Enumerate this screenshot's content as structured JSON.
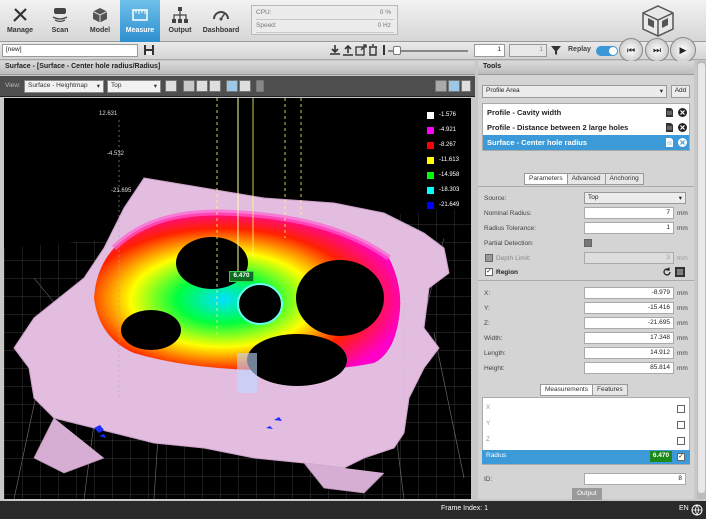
{
  "toolbar": {
    "items": [
      {
        "label": "Manage",
        "icon": "tools-icon"
      },
      {
        "label": "Scan",
        "icon": "scan-icon"
      },
      {
        "label": "Model",
        "icon": "cube-icon"
      },
      {
        "label": "Measure",
        "icon": "ruler-icon"
      },
      {
        "label": "Output",
        "icon": "network-icon"
      },
      {
        "label": "Dashboard",
        "icon": "dashboard-icon"
      }
    ],
    "active": "Measure",
    "cpu_label": "CPU:",
    "cpu_value": "0 %",
    "speed_label": "Speed:",
    "speed_value": "0 Hz"
  },
  "row2": {
    "job_select": "[new]",
    "frame_value": "1",
    "frame_total": "1",
    "replay_label": "Replay",
    "replay_on": true
  },
  "surface_panel": {
    "title": "Surface - [Surface - Center hole radius/Radius]",
    "view_label": "View:",
    "view_mode": "Surface - Heightmap",
    "view_direction": "Top"
  },
  "viewport": {
    "legend": [
      {
        "value": "-1.576",
        "color": "#ffffff"
      },
      {
        "value": "-4.921",
        "color": "#ff00ff"
      },
      {
        "value": "-8.267",
        "color": "#ff0000"
      },
      {
        "value": "-11.613",
        "color": "#ffff00"
      },
      {
        "value": "-14.958",
        "color": "#00ff00"
      },
      {
        "value": "-18.303",
        "color": "#00ffff"
      },
      {
        "value": "-21.649",
        "color": "#0000ff"
      }
    ],
    "axis_labels": [
      "12.631",
      "-4.532",
      "-21.695"
    ],
    "measurement_tag": "6.470"
  },
  "tools": {
    "title": "Tools",
    "profile_select": "Profile Area",
    "add_label": "Add",
    "items": [
      {
        "label": "Profile - Cavity width",
        "selected": false
      },
      {
        "label": "Profile - Distance between 2 large holes",
        "selected": false
      },
      {
        "label": "Surface - Center hole radius",
        "selected": true
      }
    ],
    "param_tabs": [
      "Parameters",
      "Advanced",
      "Anchoring"
    ],
    "source_label": "Source:",
    "source_value": "Top",
    "nominal_label": "Nominal Radius:",
    "nominal_value": "7",
    "tolerance_label": "Radius Tolerance:",
    "tolerance_value": "1",
    "partial_label": "Partial Detection:",
    "depth_label": "Depth Limit:",
    "depth_value": "3",
    "region_label": "Region",
    "region": [
      {
        "label": "X:",
        "value": "-8.979"
      },
      {
        "label": "Y:",
        "value": "-15.416"
      },
      {
        "label": "Z:",
        "value": "-21.695"
      },
      {
        "label": "Width:",
        "value": "17.348"
      },
      {
        "label": "Length:",
        "value": "14.912"
      },
      {
        "label": "Height:",
        "value": "85.814"
      }
    ],
    "unit": "mm",
    "meas_tabs": [
      "Measurements",
      "Features"
    ],
    "measurements": [
      {
        "label": "X",
        "value": ""
      },
      {
        "label": "Y",
        "value": ""
      },
      {
        "label": "Z",
        "value": ""
      },
      {
        "label": "Radius",
        "value": "6.470"
      }
    ],
    "id_label": "ID:",
    "id_value": "8",
    "output_tab": "Output"
  },
  "status": {
    "frame_index": "Frame Index: 1",
    "language": "EN"
  },
  "colors": {
    "accent": "#3d9ad8",
    "pass": "#1a8a1a"
  }
}
